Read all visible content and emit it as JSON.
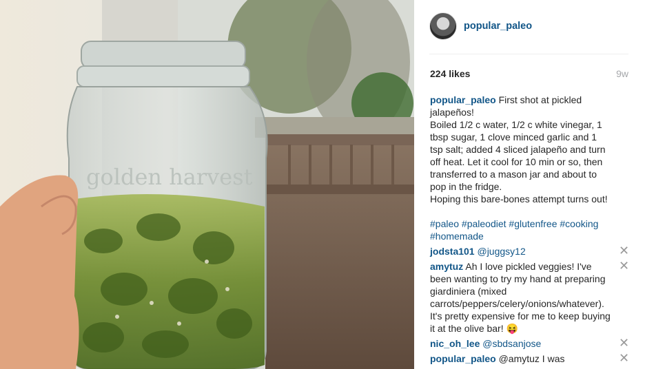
{
  "post": {
    "username": "popular_paleo",
    "likes": "224 likes",
    "age": "9w"
  },
  "caption": {
    "username": "popular_paleo",
    "text": "First shot at pickled jalapeños!\nBoiled 1/2 c water, 1/2 c white vinegar, 1 tbsp sugar, 1 clove minced garlic and 1 tsp salt; added 4 sliced jalapeño and turn off heat. Let it cool for 10 min or so, then transferred to a mason jar and about to pop in the fridge.\nHoping this bare-bones attempt turns out!",
    "hashtags": "#paleo #paleodiet #glutenfree #cooking #homemade"
  },
  "comments": [
    {
      "username": "jodsta101",
      "text": "@juggsy12"
    },
    {
      "username": "amytuz",
      "text": "Ah I love pickled veggies! I've been wanting to try my hand at preparing giardiniera (mixed carrots/peppers/celery/onions/whatever). It's pretty expensive for me to keep buying it at the olive bar! 😝"
    },
    {
      "username": "nic_oh_lee",
      "text": "@sbdsanjose"
    },
    {
      "username": "popular_paleo",
      "text": "@amytuz I was"
    }
  ],
  "photo": {
    "jar_embossing": "golden harvest"
  },
  "colors": {
    "link": "#125688",
    "muted": "#a5a7aa"
  }
}
